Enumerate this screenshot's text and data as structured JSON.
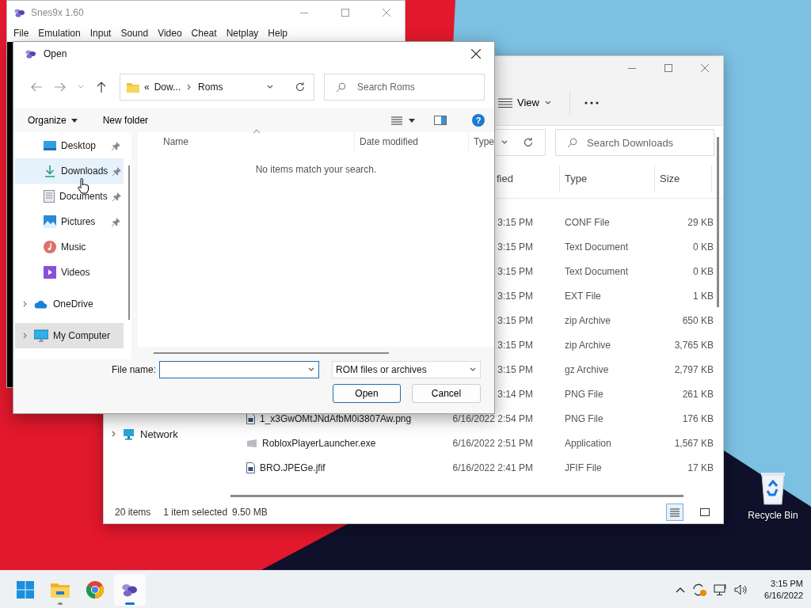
{
  "snes_window": {
    "title": "Snes9x 1.60",
    "menu": [
      "File",
      "Emulation",
      "Input",
      "Sound",
      "Video",
      "Cheat",
      "Netplay",
      "Help"
    ]
  },
  "explorer_window": {
    "view_label": "View",
    "search_placeholder": "Search Downloads",
    "columns": [
      "fied",
      "Type",
      "Size"
    ],
    "nav_items": [
      {
        "label": "Network",
        "expandable": true
      }
    ],
    "rows": [
      {
        "modified": "3:15 PM",
        "type": "CONF File",
        "size": "29 KB"
      },
      {
        "modified": "3:15 PM",
        "type": "Text Document",
        "size": "0 KB"
      },
      {
        "modified": "3:15 PM",
        "type": "Text Document",
        "size": "0 KB"
      },
      {
        "modified": "3:15 PM",
        "type": "EXT File",
        "size": "1 KB"
      },
      {
        "modified": "3:15 PM",
        "type": "zip Archive",
        "size": "650 KB"
      },
      {
        "modified": "3:15 PM",
        "type": "zip Archive",
        "size": "3,765 KB"
      },
      {
        "modified": "3:15 PM",
        "type": "gz Archive",
        "size": "2,797 KB"
      },
      {
        "modified": "3:14 PM",
        "type": "PNG File",
        "size": "261 KB"
      },
      {
        "name": "1_x3GwOMtJNdAfbM0i3807Aw.png",
        "kind": "image",
        "modified": "6/16/2022 2:54 PM",
        "type": "PNG File",
        "size": "176 KB"
      },
      {
        "name": "RobloxPlayerLauncher.exe",
        "kind": "app",
        "modified": "6/16/2022 2:51 PM",
        "type": "Application",
        "size": "1,567 KB"
      },
      {
        "name": "BRO.JPEGe.jfif",
        "kind": "image",
        "modified": "6/16/2022 2:41 PM",
        "type": "JFIF File",
        "size": "17 KB"
      }
    ],
    "status": {
      "count": "20 items",
      "selection": "1 item selected",
      "size": "9.50 MB"
    },
    "view_modes": [
      {
        "kind": "details",
        "selected": true
      },
      {
        "kind": "tiles",
        "selected": false
      }
    ]
  },
  "open_dialog": {
    "title": "Open",
    "overflow": "«",
    "breadcrumb": [
      "Dow...",
      "Roms"
    ],
    "search_placeholder": "Search Roms",
    "commands": [
      "Organize",
      "New folder"
    ],
    "help": "?",
    "nav_items": [
      {
        "label": "Desktop",
        "kind": "quick",
        "pinned": true,
        "hovered": false,
        "selected": false
      },
      {
        "label": "Downloads",
        "kind": "quick",
        "pinned": true,
        "hovered": true,
        "selected": false
      },
      {
        "label": "Documents",
        "kind": "quick",
        "pinned": true,
        "hovered": false,
        "selected": false
      },
      {
        "label": "Pictures",
        "kind": "quick",
        "pinned": true,
        "hovered": false,
        "selected": false
      },
      {
        "label": "Music",
        "kind": "quick",
        "pinned": false,
        "hovered": false,
        "selected": false
      },
      {
        "label": "Videos",
        "kind": "quick",
        "pinned": false,
        "hovered": false,
        "selected": false
      },
      {
        "label": "OneDrive",
        "kind": "root",
        "pinned": false,
        "hovered": false,
        "selected": false
      },
      {
        "label": "My Computer",
        "kind": "root",
        "pinned": false,
        "hovered": false,
        "selected": true
      }
    ],
    "columns": [
      "Name",
      "Date modified",
      "Type"
    ],
    "empty_message": "No items match your search.",
    "file_name_label": "File name:",
    "filter": "ROM files or archives",
    "buttons": [
      {
        "label": "Open",
        "default": true
      },
      {
        "label": "Cancel",
        "default": false
      }
    ]
  },
  "desktop_icons": [
    {
      "label": "Recycle Bin"
    }
  ],
  "taskbar": {
    "apps": [
      {
        "kind": "start",
        "running": false,
        "active": false
      },
      {
        "kind": "files",
        "running": true,
        "active": false
      },
      {
        "kind": "browser",
        "running": false,
        "active": false
      },
      {
        "kind": "emulator",
        "running": true,
        "active": true
      }
    ],
    "time": "3:15 PM",
    "date": "6/16/2022"
  }
}
